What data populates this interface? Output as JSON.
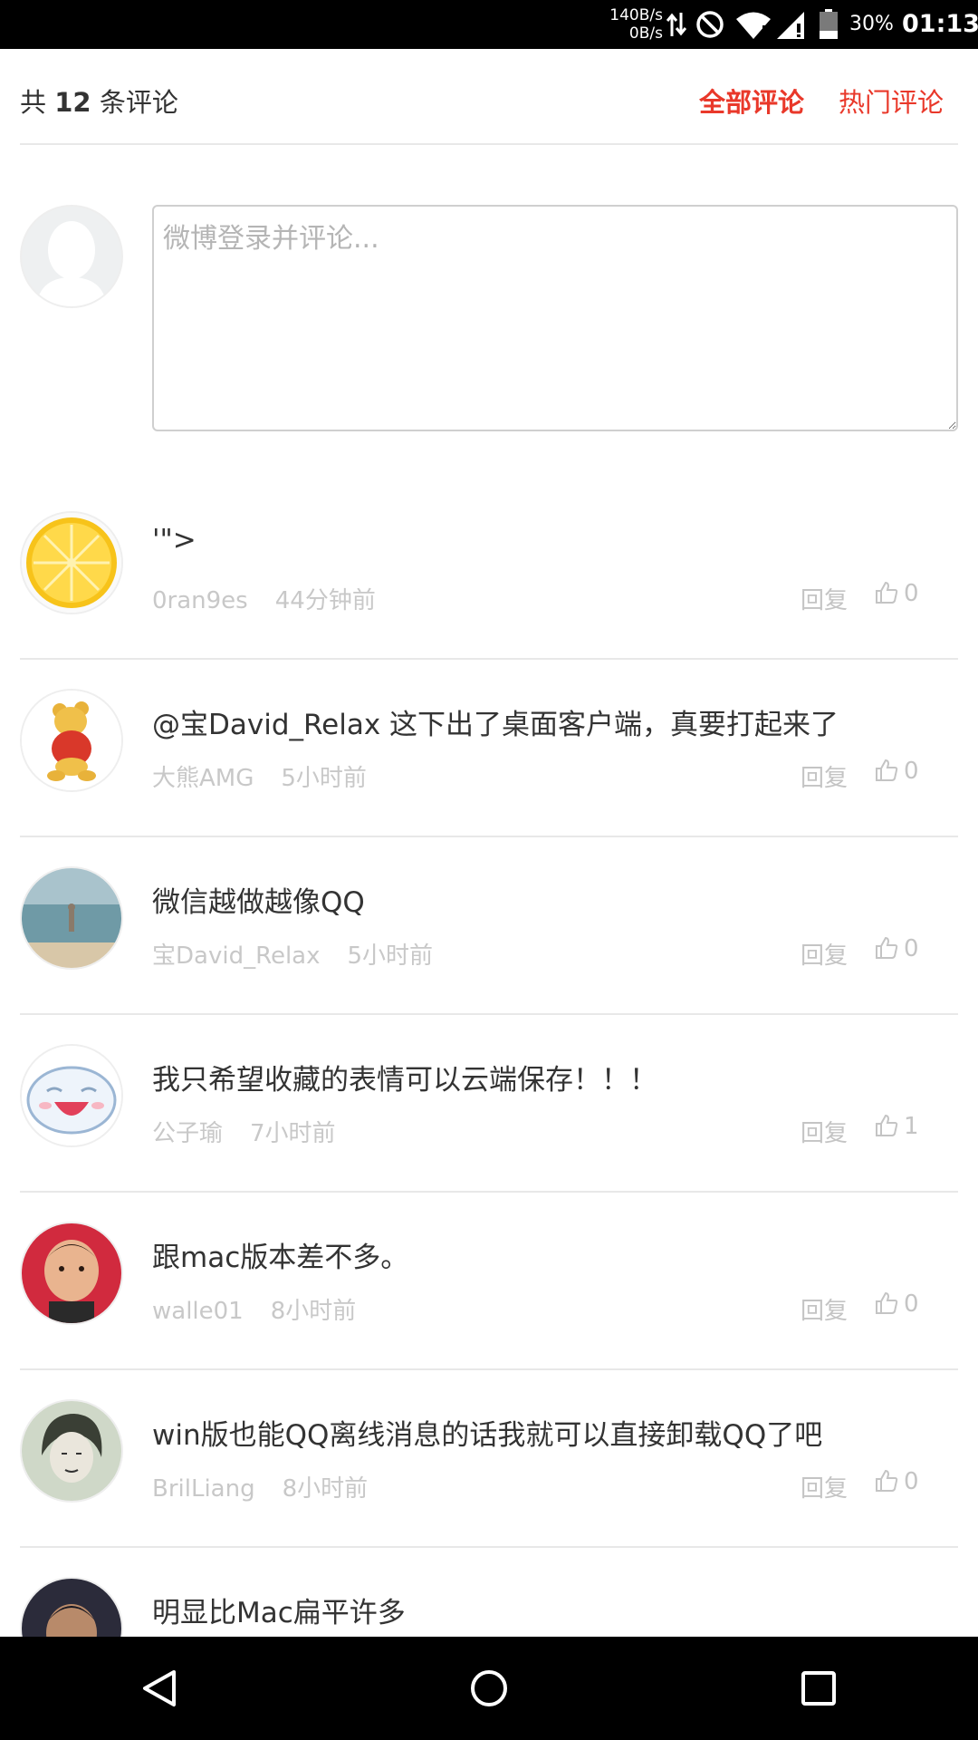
{
  "status_bar": {
    "speed_up": "140B/s",
    "speed_down": "0B/s",
    "battery": "30%",
    "time": "01:13",
    "icons": [
      "data-transfer-icon",
      "do-not-disturb-icon",
      "wifi-icon",
      "cell-signal-icon",
      "battery-icon"
    ]
  },
  "header": {
    "count_prefix": "共",
    "count": "12",
    "count_suffix": "条评论",
    "tab_all": "全部评论",
    "tab_hot": "热门评论",
    "accent_color": "#e9382a"
  },
  "compose": {
    "placeholder": "微博登录并评论..."
  },
  "actions": {
    "reply_label": "回复"
  },
  "comments": [
    {
      "text": "'\">",
      "user": "0ran9es",
      "time": "44分钟前",
      "likes": "0",
      "avatar": "lemon"
    },
    {
      "text": "@宝David_Relax 这下出了桌面客户端，真要打起来了",
      "user": "大熊AMG",
      "time": "5小时前",
      "likes": "0",
      "avatar": "winnie-the-pooh"
    },
    {
      "text": "微信越做越像QQ",
      "user": "宝David_Relax",
      "time": "5小时前",
      "likes": "0",
      "avatar": "beach-person"
    },
    {
      "text": "我只希望收藏的表情可以云端保存！！！",
      "user": "公子瑜",
      "time": "7小时前",
      "likes": "1",
      "avatar": "cartoon-face"
    },
    {
      "text": "跟mac版本差不多。",
      "user": "walle01",
      "time": "8小时前",
      "likes": "0",
      "avatar": "child-photo"
    },
    {
      "text": "win版也能QQ离线消息的话我就可以直接卸载QQ了吧",
      "user": "BrilLiang",
      "time": "8小时前",
      "likes": "0",
      "avatar": "sketch-portrait"
    },
    {
      "text": "明显比Mac扁平许多",
      "user": "",
      "time": "",
      "likes": "",
      "avatar": "person-photo"
    }
  ],
  "navbar": {
    "icons": [
      "back-icon",
      "home-icon",
      "recents-icon"
    ]
  }
}
